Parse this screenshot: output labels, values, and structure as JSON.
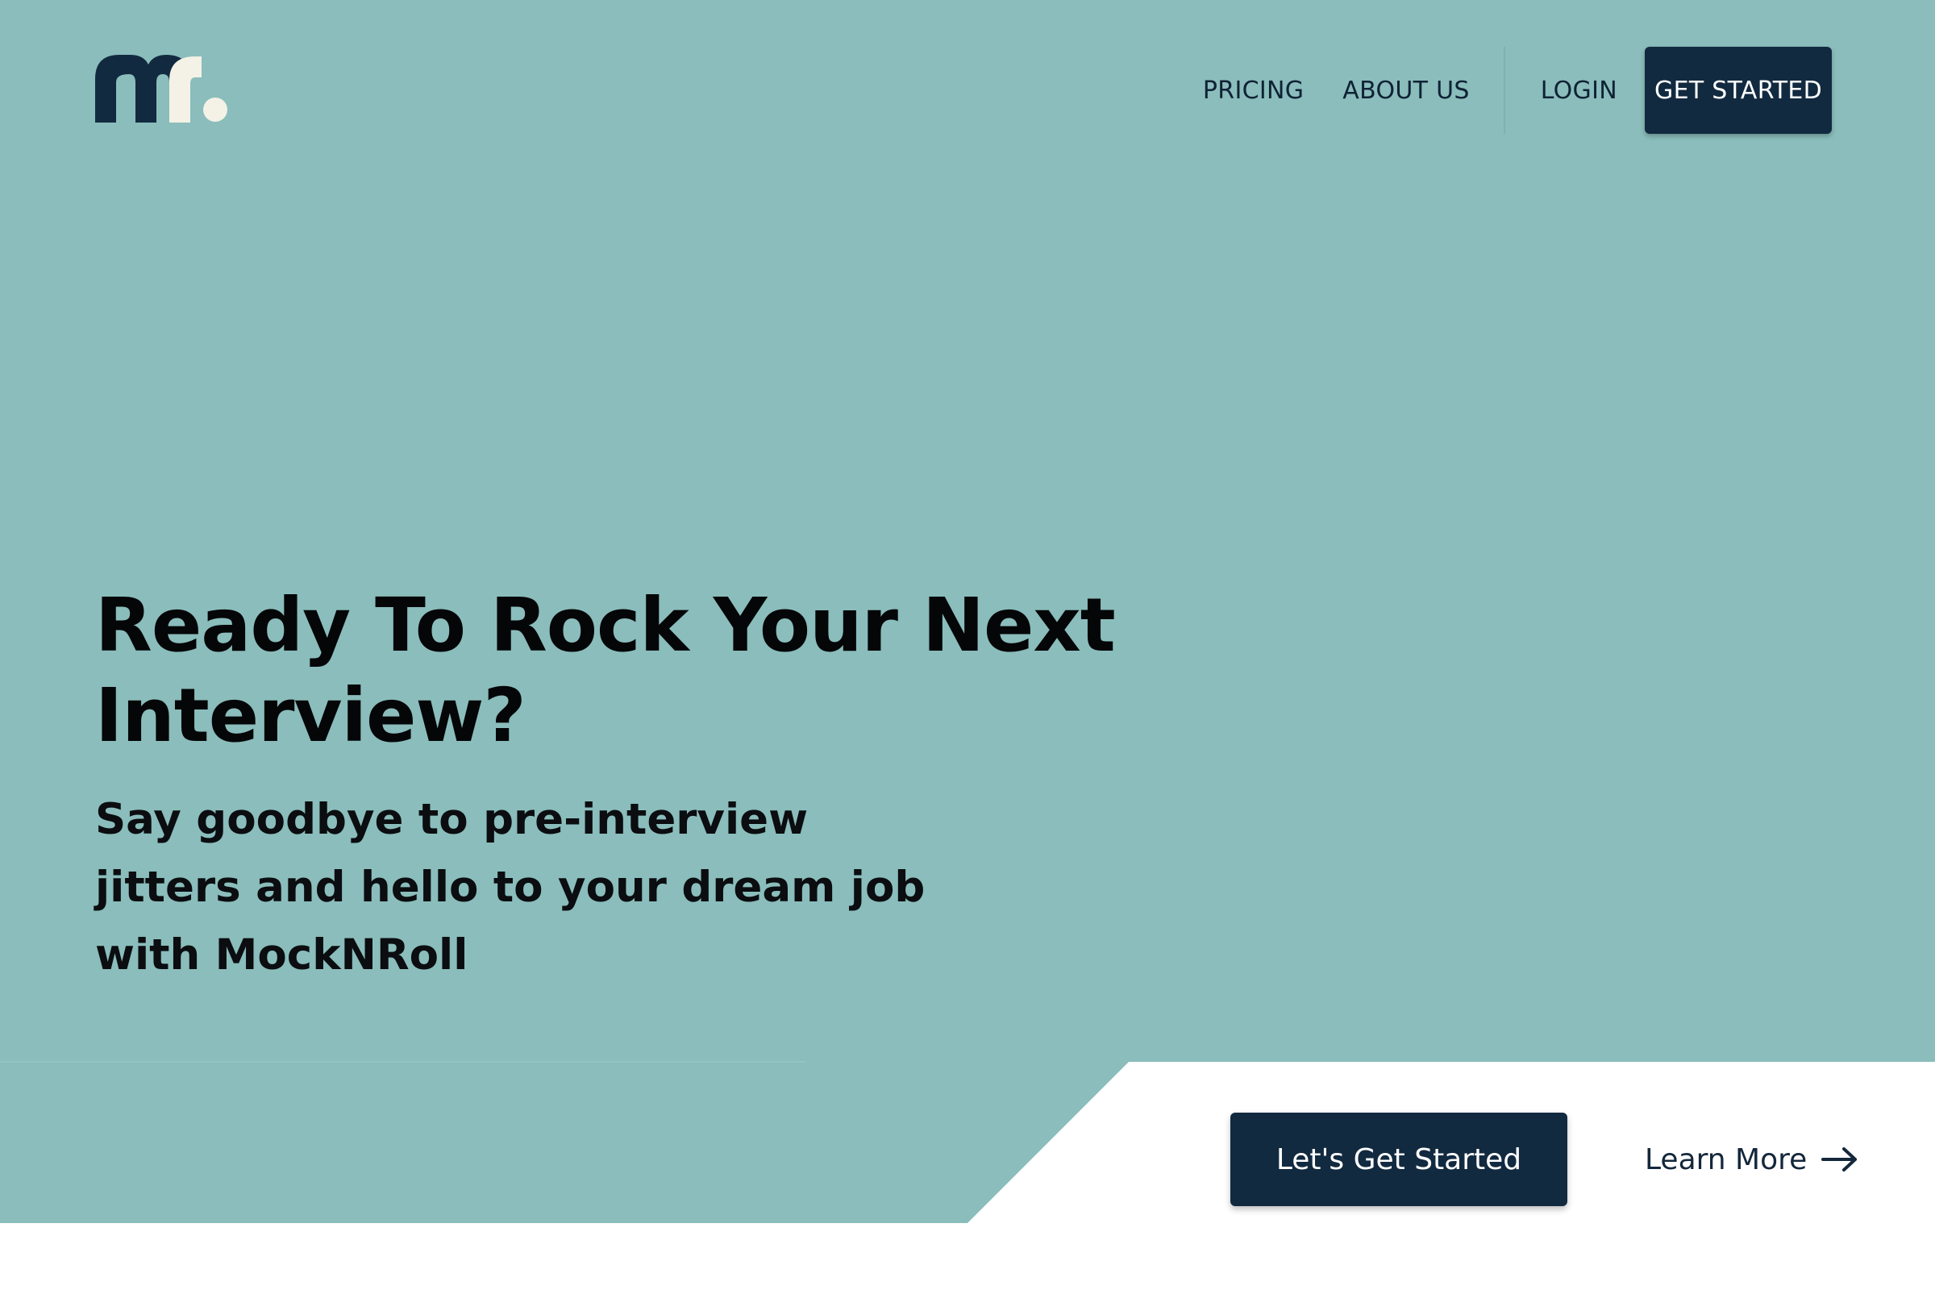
{
  "brand": {
    "logo_text": "mr.",
    "colors": {
      "hero_bg": "#8abdbb",
      "navy": "#122a40",
      "logo_dot": "#f4f1e6"
    }
  },
  "nav": {
    "items": [
      {
        "label": "PRICING"
      },
      {
        "label": "ABOUT US"
      },
      {
        "label": "LOGIN"
      }
    ],
    "cta_label": "GET STARTED"
  },
  "hero": {
    "title": "Ready To Rock Your Next Interview?",
    "subtitle": "Say goodbye to pre-interview jitters and hello to your dream job with MockNRoll"
  },
  "cta": {
    "primary_label": "Let's Get Started",
    "secondary_label": "Learn More",
    "secondary_icon": "arrow-right-icon"
  }
}
